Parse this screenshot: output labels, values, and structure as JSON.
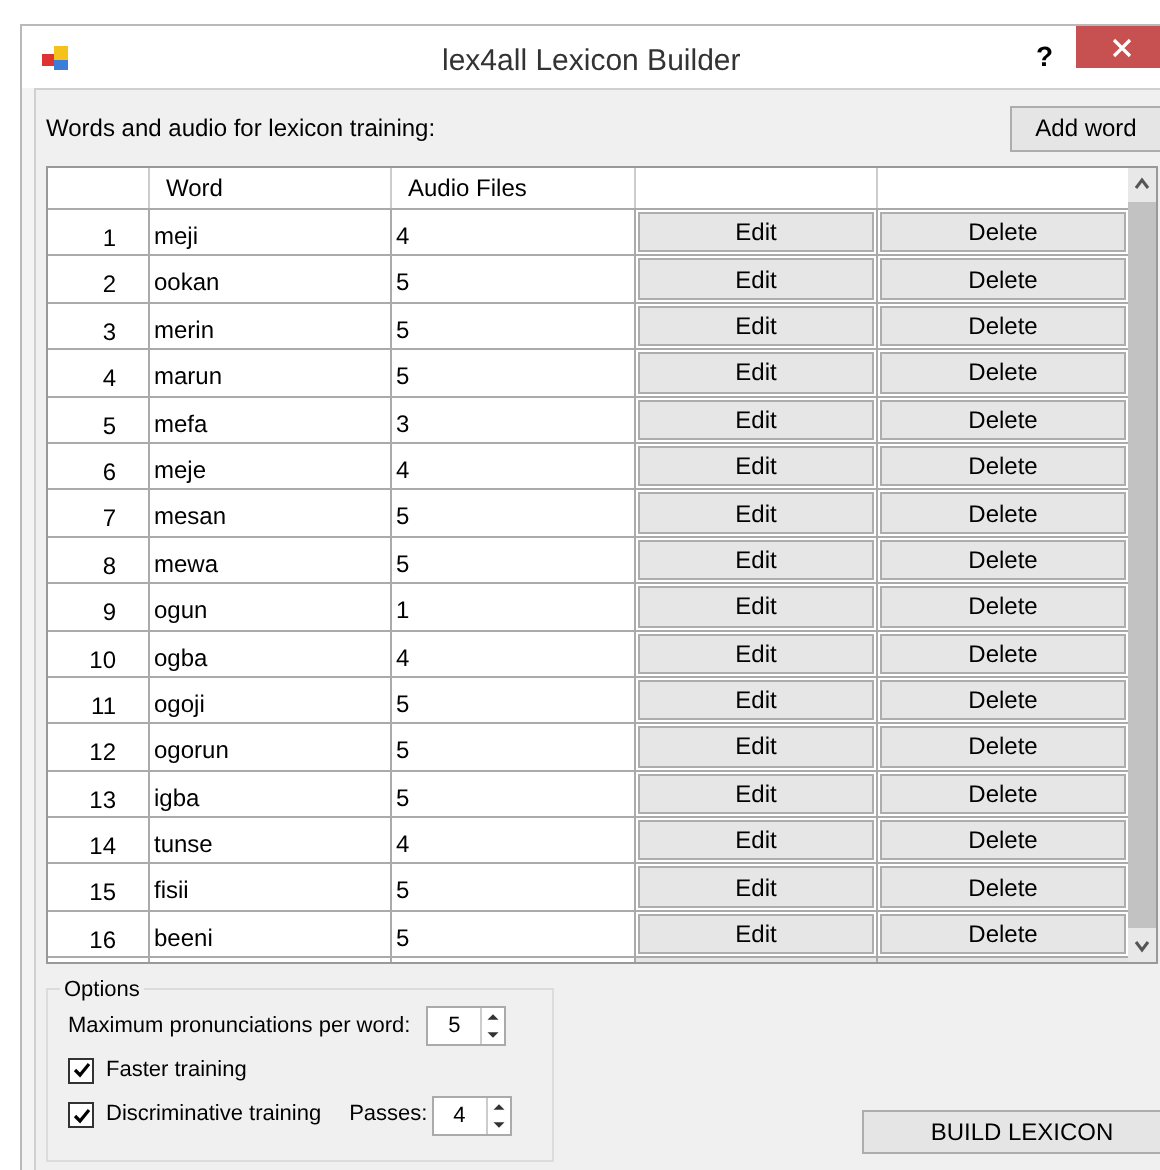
{
  "window": {
    "title": "lex4all Lexicon Builder",
    "help": "?"
  },
  "header_label": "Words and audio for lexicon training:",
  "add_button": "Add word",
  "table": {
    "columns": [
      "Word",
      "Audio Files"
    ],
    "rows": [
      {
        "number": "1",
        "word": "meji",
        "audio": "4",
        "edit": "Edit",
        "delete": "Delete"
      },
      {
        "number": "2",
        "word": "ookan",
        "audio": "5",
        "edit": "Edit",
        "delete": "Delete"
      },
      {
        "number": "3",
        "word": "merin",
        "audio": "5",
        "edit": "Edit",
        "delete": "Delete"
      },
      {
        "number": "4",
        "word": "marun",
        "audio": "5",
        "edit": "Edit",
        "delete": "Delete"
      },
      {
        "number": "5",
        "word": "mefa",
        "audio": "3",
        "edit": "Edit",
        "delete": "Delete"
      },
      {
        "number": "6",
        "word": "meje",
        "audio": "4",
        "edit": "Edit",
        "delete": "Delete"
      },
      {
        "number": "7",
        "word": "mesan",
        "audio": "5",
        "edit": "Edit",
        "delete": "Delete"
      },
      {
        "number": "8",
        "word": "mewa",
        "audio": "5",
        "edit": "Edit",
        "delete": "Delete"
      },
      {
        "number": "9",
        "word": "ogun",
        "audio": "1",
        "edit": "Edit",
        "delete": "Delete"
      },
      {
        "number": "10",
        "word": "ogba",
        "audio": "4",
        "edit": "Edit",
        "delete": "Delete"
      },
      {
        "number": "11",
        "word": "ogoji",
        "audio": "5",
        "edit": "Edit",
        "delete": "Delete"
      },
      {
        "number": "12",
        "word": "ogorun",
        "audio": "5",
        "edit": "Edit",
        "delete": "Delete"
      },
      {
        "number": "13",
        "word": "igba",
        "audio": "5",
        "edit": "Edit",
        "delete": "Delete"
      },
      {
        "number": "14",
        "word": "tunse",
        "audio": "4",
        "edit": "Edit",
        "delete": "Delete"
      },
      {
        "number": "15",
        "word": "fisii",
        "audio": "5",
        "edit": "Edit",
        "delete": "Delete"
      },
      {
        "number": "16",
        "word": "beeni",
        "audio": "5",
        "edit": "Edit",
        "delete": "Delete"
      }
    ]
  },
  "options": {
    "title": "Options",
    "max_label": "Maximum pronunciations per word:",
    "max_value": "5",
    "faster": {
      "label": "Faster training",
      "checked": true
    },
    "discriminative": {
      "label": "Discriminative training",
      "checked": true
    },
    "passes_label": "Passes:",
    "passes_value": "4"
  },
  "build_button": "BUILD LEXICON"
}
